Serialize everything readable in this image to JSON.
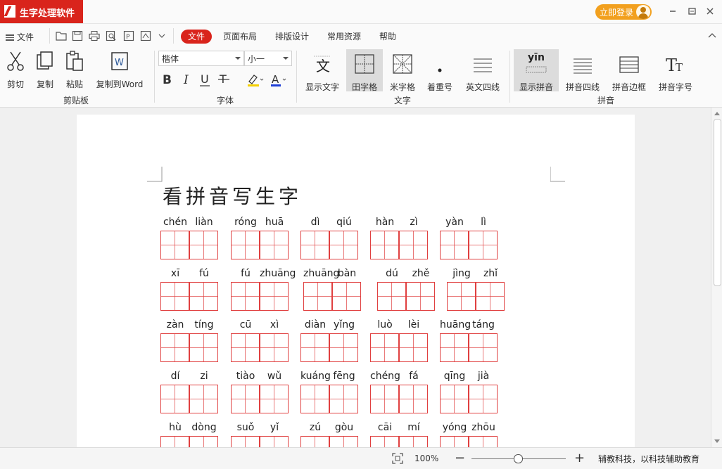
{
  "app": {
    "title": "生字处理软件",
    "login_label": "立即登录",
    "accent": "#d9241c",
    "login_color": "#f2a01e"
  },
  "window_controls": [
    "minimize-icon",
    "restore-icon",
    "close-icon"
  ],
  "menu": {
    "file_label": "文件",
    "quick_access": [
      "open-folder-icon",
      "save-icon",
      "print-icon",
      "print-preview-icon",
      "export-icon",
      "pinyin-export-icon",
      "chevron-down-icon"
    ],
    "tabs": [
      {
        "label": "文件",
        "active": true
      },
      {
        "label": "页面布局",
        "active": false
      },
      {
        "label": "排版设计",
        "active": false
      },
      {
        "label": "常用资源",
        "active": false
      },
      {
        "label": "帮助",
        "active": false
      }
    ]
  },
  "ribbon": {
    "clipboard": {
      "group": "剪贴板",
      "cut": "剪切",
      "copy": "复制",
      "paste": "粘贴",
      "copy_word": "复制到Word"
    },
    "font": {
      "group": "字体",
      "family": "楷体",
      "size": "小一"
    },
    "text": {
      "group": "文字",
      "show_text": "显示文字",
      "tian_grid": "田字格",
      "mi_grid": "米字格",
      "emphasis": "着重号",
      "english_lines": "英文四线"
    },
    "pinyin": {
      "group": "拼音",
      "show_pinyin_glyph": "yīn",
      "show_pinyin": "显示拼音",
      "pinyin_lines": "拼音四线",
      "pinyin_border": "拼音边框",
      "pinyin_font": "拼音字号"
    }
  },
  "document": {
    "title": "看拼音写生字",
    "rows": [
      [
        [
          "chén",
          "liàn"
        ],
        [
          "róng",
          "huā"
        ],
        [
          "dì",
          "qiú"
        ],
        [
          "hàn",
          "zì"
        ],
        [
          "yàn",
          "lì"
        ]
      ],
      [
        [
          "xī",
          "fú"
        ],
        [
          "fú",
          "zhuāng"
        ],
        [
          "zhuāng",
          "bàn"
        ],
        [
          "dú",
          "zhě"
        ],
        [
          "jìng",
          "zhǐ"
        ]
      ],
      [
        [
          "zàn",
          "tíng"
        ],
        [
          "cū",
          "xì"
        ],
        [
          "diàn",
          "yǐng"
        ],
        [
          "luò",
          "lèi"
        ],
        [
          "huāng",
          "táng"
        ]
      ],
      [
        [
          "dí",
          "zi"
        ],
        [
          "tiào",
          "wǔ"
        ],
        [
          "kuáng",
          "fēng"
        ],
        [
          "chéng",
          "fá"
        ],
        [
          "qīng",
          "jià"
        ]
      ],
      [
        [
          "hù",
          "dòng"
        ],
        [
          "suǒ",
          "yǐ"
        ],
        [
          "zú",
          "gòu"
        ],
        [
          "cāi",
          "mí"
        ],
        [
          "yóng",
          "zhōu"
        ]
      ]
    ]
  },
  "status": {
    "zoom": "100%",
    "zoom_minus": "−",
    "zoom_plus": "+",
    "zoom_fraction": 0.49,
    "slogan": "辅教科技，以科技辅助教育"
  }
}
